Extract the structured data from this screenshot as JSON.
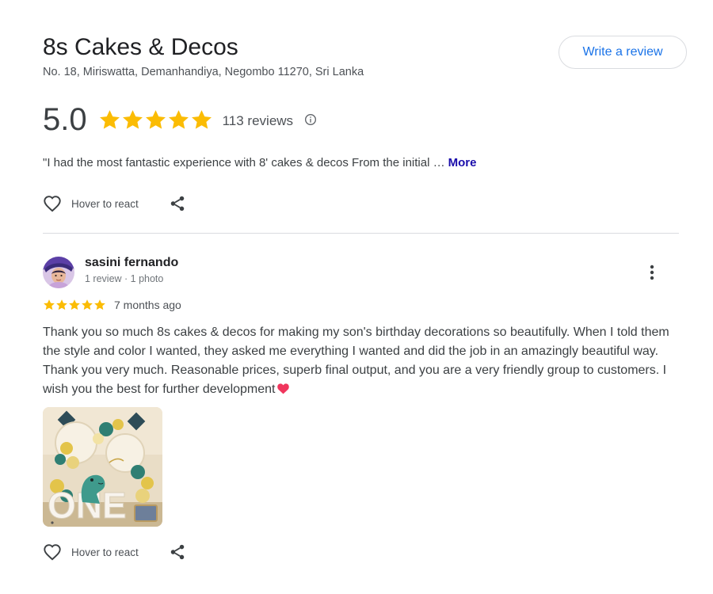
{
  "business": {
    "name": "8s Cakes & Decos",
    "address": "No. 18, Miriswatta, Demanhandiya, Negombo 11270, Sri Lanka",
    "write_review_label": "Write a review",
    "rating": "5.0",
    "rating_stars": 5,
    "review_count": "113 reviews",
    "quote": "\"I had the most fantastic experience with 8' cakes & decos From the initial …",
    "more_label": "More",
    "react_label": "Hover to react"
  },
  "review": {
    "reviewer_name": "sasini fernando",
    "reviewer_meta": "1 review · 1 photo",
    "stars": 5,
    "date": "7 months ago",
    "text": "Thank you so much 8s cakes & decos for making my son's birthday decorations so beautifully. When I told them the style and color I wanted, they asked me everything I wanted and did the job in an amazingly beautiful way. Thank you very much. Reasonable prices, superb final output, and you are a very friendly group to customers. I wish you the best for further development",
    "react_label": "Hover to react"
  },
  "colors": {
    "star": "#fbbc04",
    "link_blue": "#1a73e8",
    "more_link": "#1a0dab",
    "heart_emoji": "#f0365d"
  },
  "icons": {
    "star": "star-icon",
    "info": "info-icon",
    "heart": "heart-outline-icon",
    "share": "share-icon",
    "menu": "more-vert-icon",
    "emoji": "red-heart-emoji-icon"
  }
}
